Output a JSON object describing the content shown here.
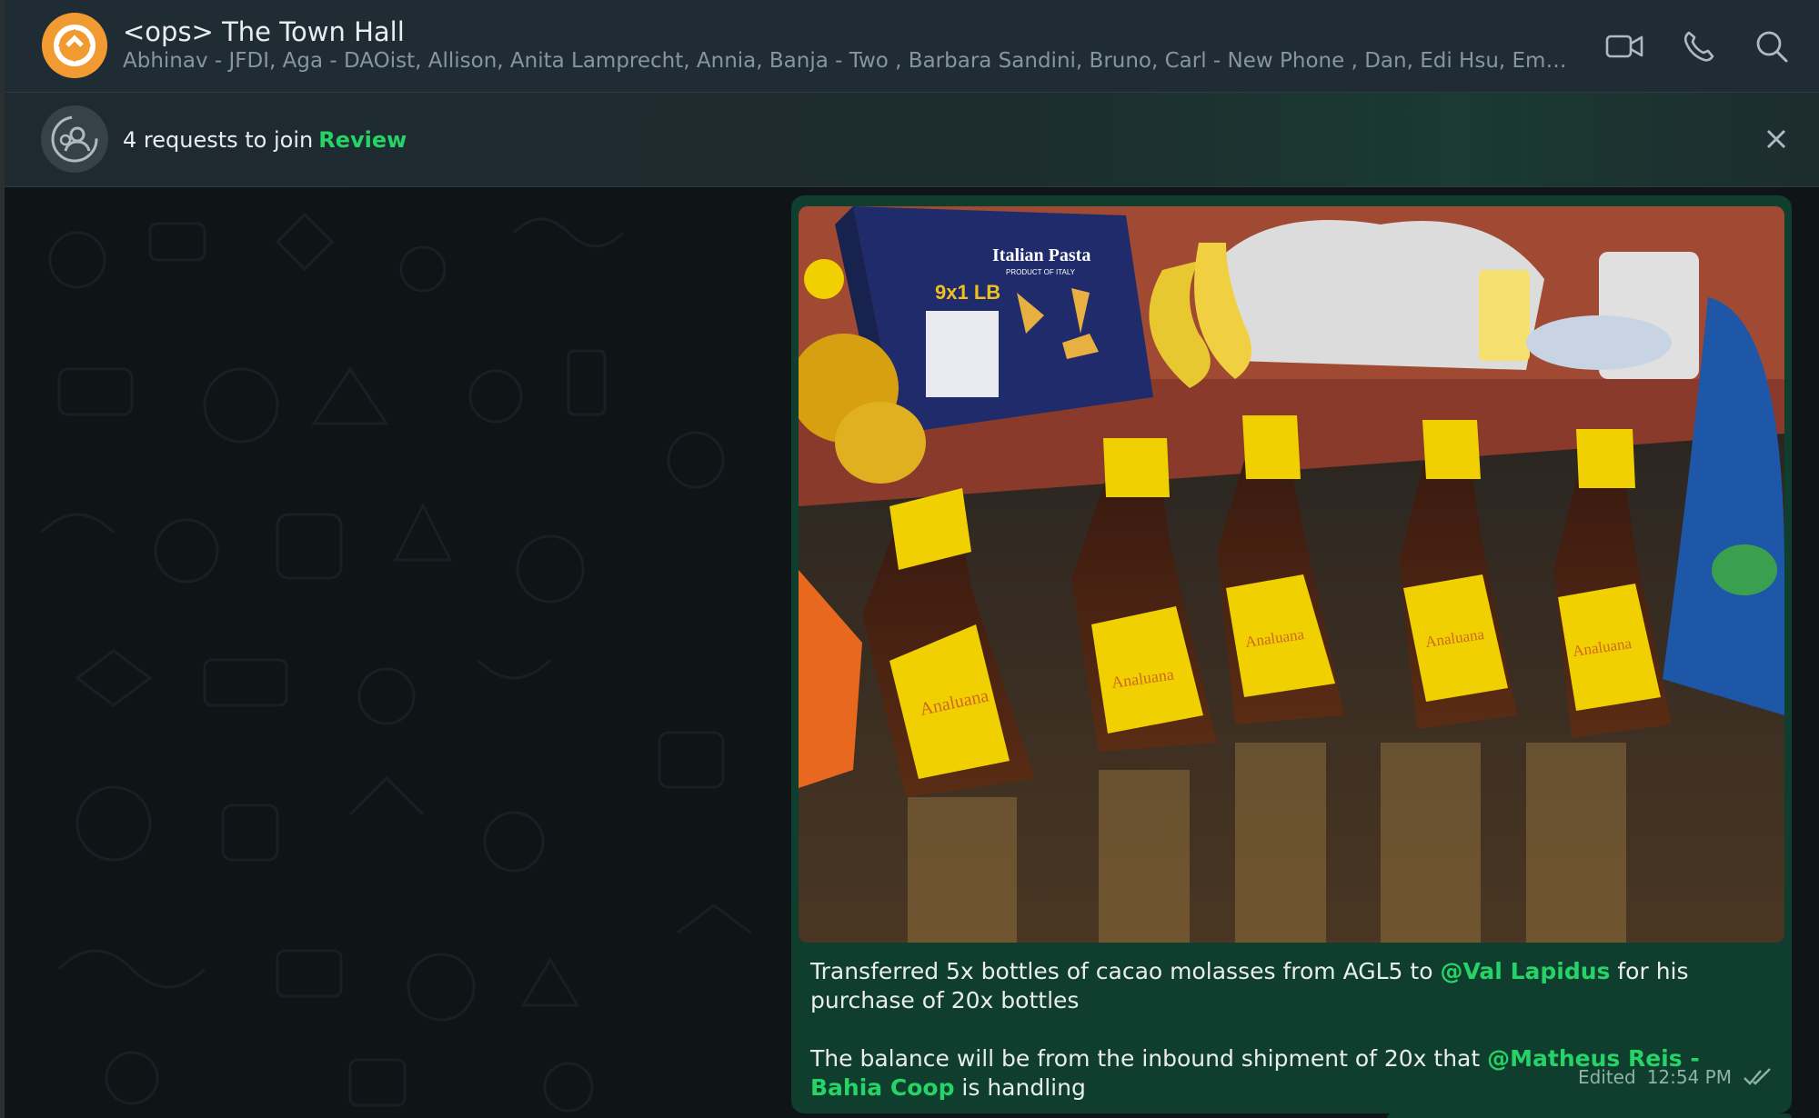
{
  "header": {
    "title": "<ops> The Town Hall",
    "members": "Abhinav - JFDI, Aga - DAOist, Allison, Anita Lamprecht, Annia, Banja - Two , Barbara Sandini, Bruno, Carl - New Phone , Dan, Edi Hsu, Emelin - B...",
    "icons": [
      "video-call-icon",
      "voice-call-icon",
      "search-icon"
    ]
  },
  "banner": {
    "text": "4 requests to join",
    "link": "Review"
  },
  "message": {
    "line1_before": "Transferred 5x bottles of cacao molasses from AGL5 to ",
    "mention1": "@Val Lapidus",
    "line1_after": " for his purchase of 20x bottles",
    "line2_before": "The balance will be from the inbound shipment of 20x that ",
    "mention2": "@Matheus Reis - Bahia Coop",
    "line2_after": " is handling",
    "edited": "Edited",
    "time": "12:54 PM"
  },
  "photo": {
    "box_title": "Italian Pasta",
    "box_sub": "PRODUCT OF ITALY",
    "box_weight": "9x1 LB",
    "label_brand": "Analuana"
  },
  "colors": {
    "accent": "#25d366",
    "bubble": "#0f3d2e",
    "header": "#202c33",
    "bottle_cap": "#f0d000"
  }
}
